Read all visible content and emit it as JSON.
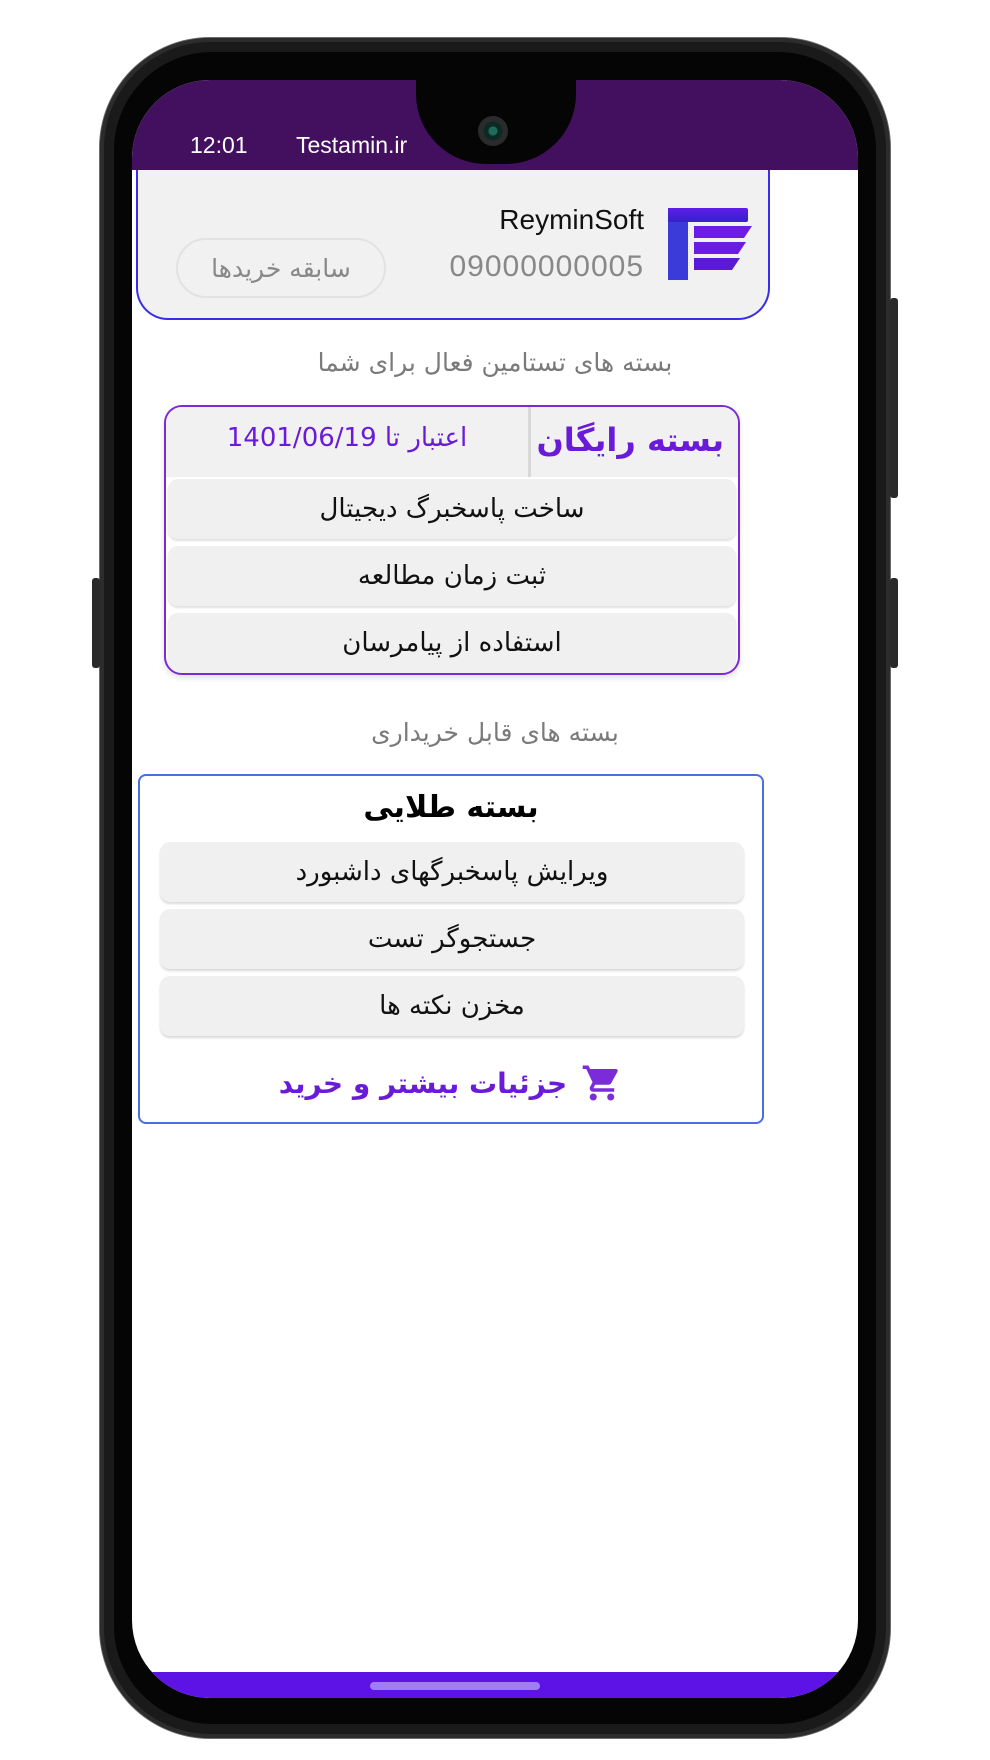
{
  "status_bar": {
    "time": "12:01",
    "site": "Testamin.ir"
  },
  "profile": {
    "name": "ReyminSoft",
    "phone": "09000000005",
    "history_button_label": "سابقه خریدها",
    "logo_icon": "testamin-logo-icon"
  },
  "active_section_title": "بسته های تستامین فعال برای شما",
  "free_package": {
    "title": "بسته رایگان",
    "validity": "اعتبار تا 1401/06/19",
    "features": [
      "ساخت پاسخبرگ دیجیتال",
      "ثبت زمان مطالعه",
      "استفاده از پیامرسان"
    ]
  },
  "purchasable_section_title": "بسته های قابل خریداری",
  "gold_package": {
    "title": "بسته طلایی",
    "features": [
      "ویرایش پاسخبرگهای داشبورد",
      "جستجوگر تست",
      "مخزن نکته ها"
    ],
    "buy_label": "جزئیات بیشتر و خرید",
    "buy_icon": "shopping-cart-icon"
  },
  "colors": {
    "status_bar": "#43105f",
    "accent": "#6a1bd9",
    "card_border": "#3a2de6",
    "nav_bar": "#5d12e6"
  }
}
